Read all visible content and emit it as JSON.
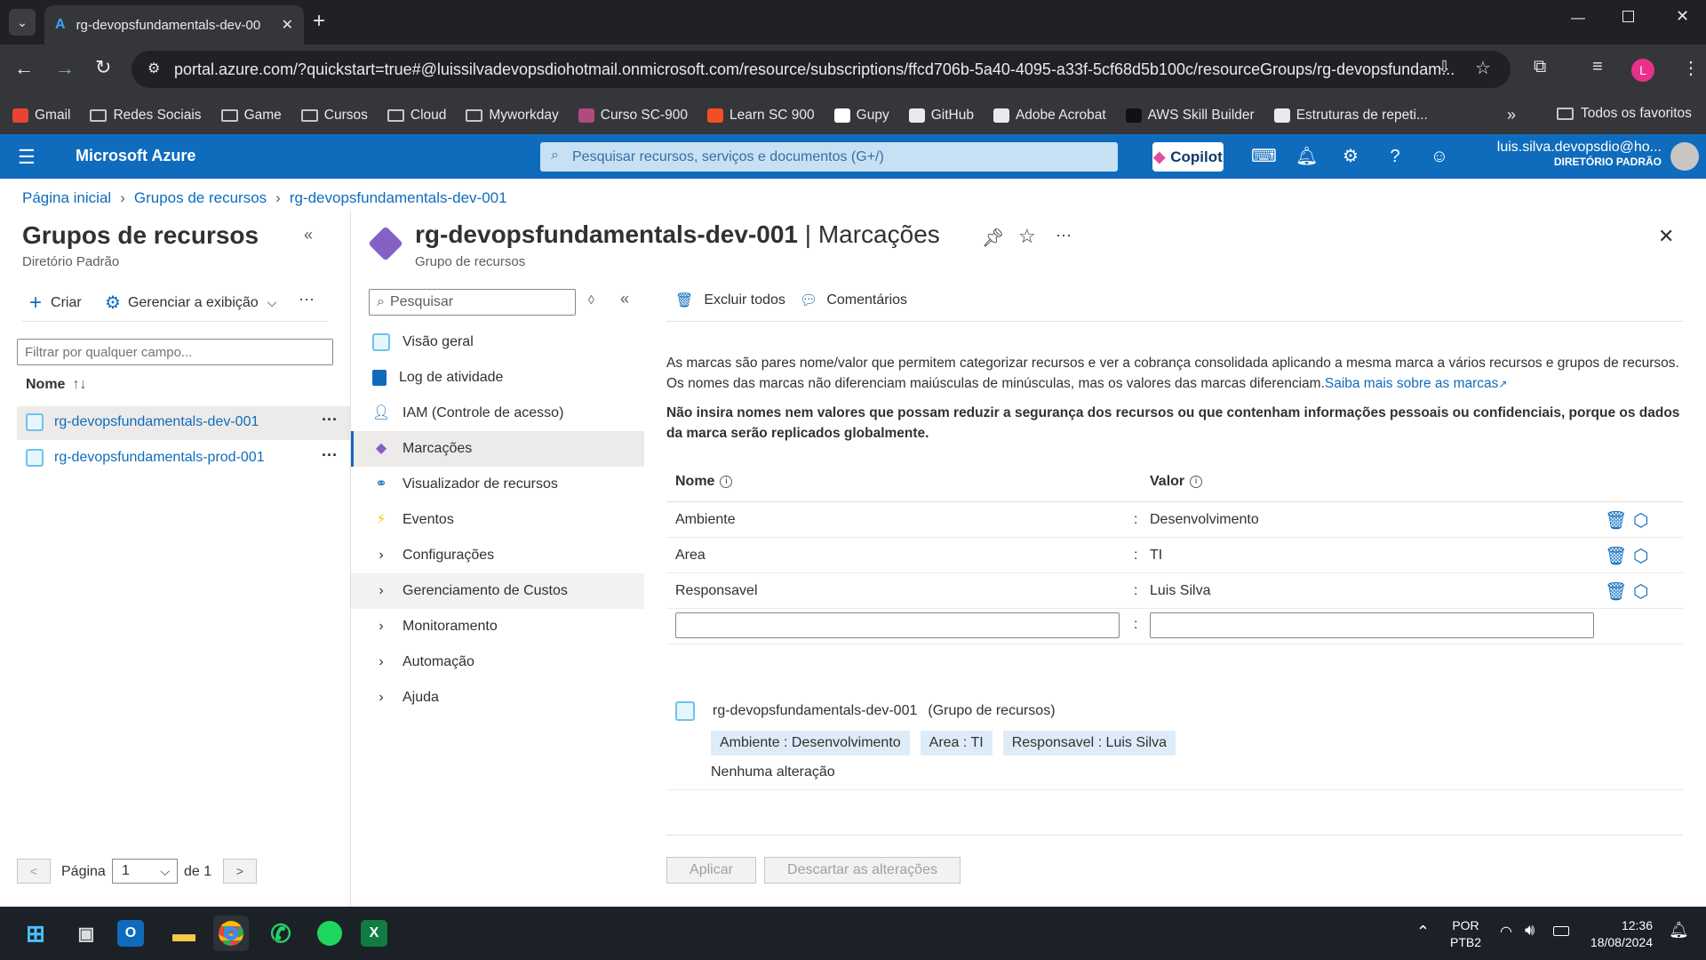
{
  "browser": {
    "tab_title": "rg-devopsfundamentals-dev-00",
    "url": "portal.azure.com/?quickstart=true#@luissilvadevopsdiohotmail.onmicrosoft.com/resource/subscriptions/ffcd706b-5a40-4095-a33f-5cf68d5b100c/resourceGroups/rg-devopsfundam...",
    "profile_initial": "L",
    "bookmarks": [
      {
        "label": "Gmail",
        "icon": "gmail-icon"
      },
      {
        "label": "Redes Sociais",
        "icon": "folder-icon"
      },
      {
        "label": "Game",
        "icon": "folder-icon"
      },
      {
        "label": "Cursos",
        "icon": "folder-icon"
      },
      {
        "label": "Cloud",
        "icon": "folder-icon"
      },
      {
        "label": "Myworkday",
        "icon": "folder-icon"
      },
      {
        "label": "Curso SC-900",
        "icon": "course-icon"
      },
      {
        "label": "Learn SC 900",
        "icon": "microsoft-icon"
      },
      {
        "label": "Gupy",
        "icon": "gupy-icon"
      },
      {
        "label": "GitHub",
        "icon": "github-icon"
      },
      {
        "label": "Adobe Acrobat",
        "icon": "acrobat-icon"
      },
      {
        "label": "AWS Skill Builder",
        "icon": "aws-icon"
      },
      {
        "label": "Estruturas de repeti...",
        "icon": "layers-icon"
      }
    ],
    "all_bookmarks": "Todos os favoritos"
  },
  "azure": {
    "brand": "Microsoft Azure",
    "search_placeholder": "Pesquisar recursos, serviços e documentos (G+/)",
    "copilot": "Copilot",
    "user_name": "luis.silva.devopsdio@ho...",
    "user_dir": "DIRETÓRIO PADRÃO"
  },
  "breadcrumb": [
    "Página inicial",
    "Grupos de recursos",
    "rg-devopsfundamentals-dev-001"
  ],
  "left": {
    "title": "Grupos de recursos",
    "subtitle": "Diretório Padrão",
    "create": "Criar",
    "manage_view": "Gerenciar a exibição",
    "filter_placeholder": "Filtrar por qualquer campo...",
    "col_name": "Nome",
    "items": [
      "rg-devopsfundamentals-dev-001",
      "rg-devopsfundamentals-prod-001"
    ],
    "page_label": "Página",
    "page_value": "1",
    "page_of": "de 1",
    "prev": "<",
    "next": ">"
  },
  "resource": {
    "name": "rg-devopsfundamentals-dev-001",
    "section": "| Marcações",
    "type": "Grupo de recursos"
  },
  "menu": {
    "search_placeholder": "Pesquisar",
    "items": [
      "Visão geral",
      "Log de atividade",
      "IAM (Controle de acesso)",
      "Marcações",
      "Visualizador de recursos",
      "Eventos",
      "Configurações",
      "Gerenciamento de Custos",
      "Monitoramento",
      "Automação",
      "Ajuda"
    ]
  },
  "tags": {
    "delete_all": "Excluir todos",
    "comments": "Comentários",
    "description": "As marcas são pares nome/valor que permitem categorizar recursos e ver a cobrança consolidada aplicando a mesma marca a vários recursos e grupos de recursos. Os nomes das marcas não diferenciam maiúsculas de minúsculas, mas os valores das marcas diferenciam.",
    "learn_more": "Saiba mais sobre as marcas",
    "warning": "Não insira nomes nem valores que possam reduzir a segurança dos recursos ou que contenham informações pessoais ou confidenciais, porque os dados da marca serão replicados globalmente.",
    "col_name": "Nome",
    "col_value": "Valor",
    "rows": [
      {
        "name": "Ambiente",
        "value": "Desenvolvimento"
      },
      {
        "name": "Area",
        "value": "TI"
      },
      {
        "name": "Responsavel",
        "value": "Luis Silva"
      }
    ],
    "new_name": "",
    "new_value": "",
    "summary_resource": "rg-devopsfundamentals-dev-001",
    "summary_type": "(Grupo de recursos)",
    "chips": [
      "Ambiente : Desenvolvimento",
      "Area : TI",
      "Responsavel : Luis Silva"
    ],
    "no_change": "Nenhuma alteração",
    "apply": "Aplicar",
    "discard": "Descartar as alterações"
  },
  "taskbar": {
    "lang1": "POR",
    "lang2": "PTB2",
    "time": "12:36",
    "date": "18/08/2024"
  }
}
